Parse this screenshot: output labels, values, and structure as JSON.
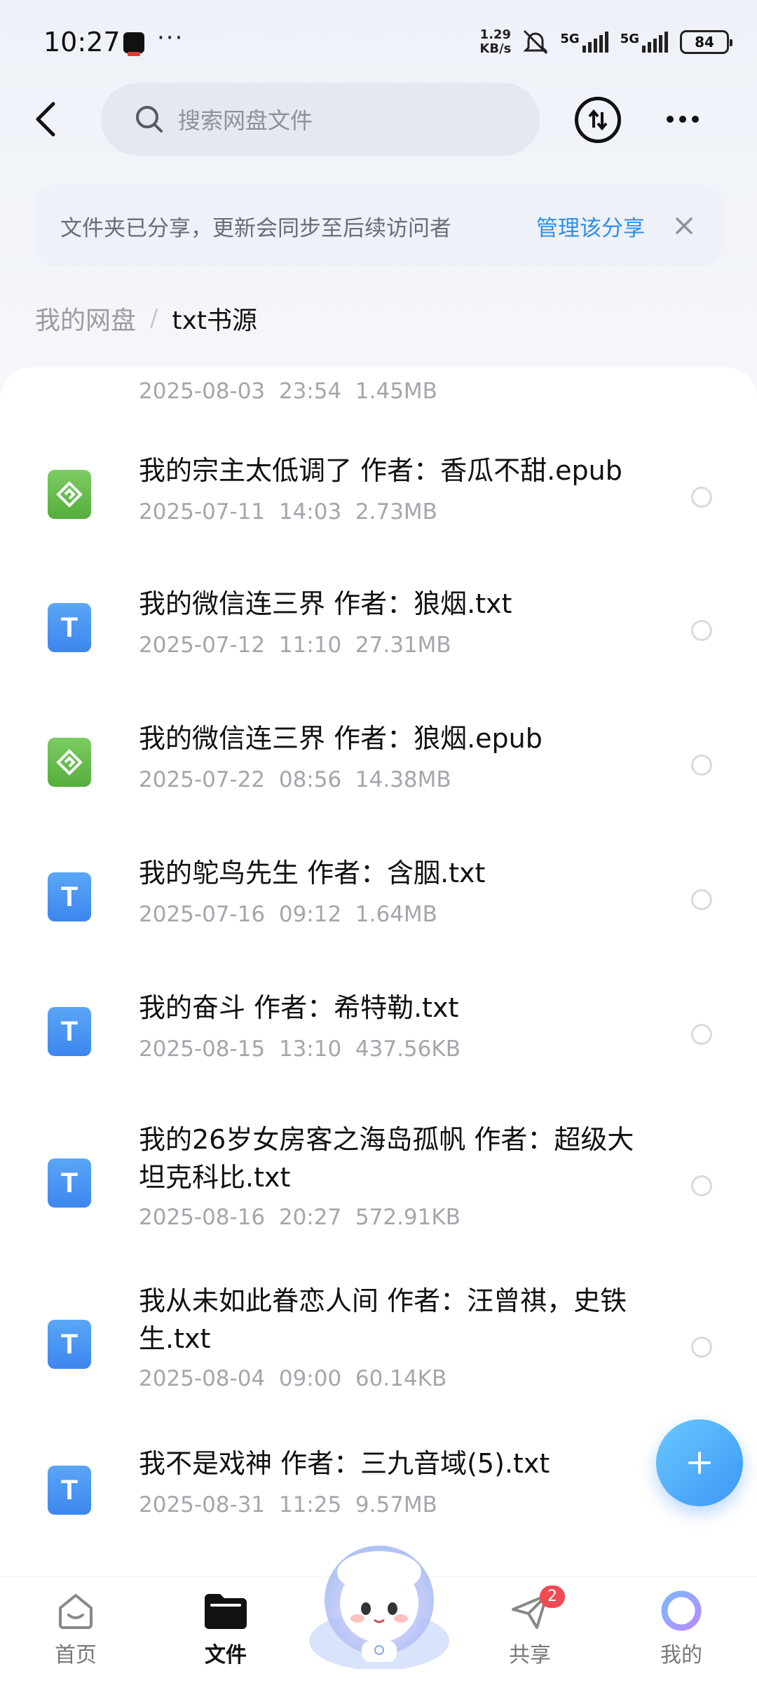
{
  "status_bar": {
    "time": "10:27",
    "more": "···",
    "net_speed_value": "1.29",
    "net_speed_unit": "KB/s",
    "signal_1": "5G",
    "signal_2": "5G",
    "battery": "84"
  },
  "header": {
    "search_placeholder": "搜索网盘文件"
  },
  "banner": {
    "text": "文件夹已分享，更新会同步至后续访问者",
    "link": "管理该分享"
  },
  "breadcrumb": {
    "root": "我的网盘",
    "separator": "/",
    "current": "txt书源"
  },
  "files": [
    {
      "name": "",
      "date": "2025-08-03",
      "time": "23:54",
      "size": "1.45MB",
      "type": "partial"
    },
    {
      "name": "我的宗主太低调了 作者：香瓜不甜.epub",
      "date": "2025-07-11",
      "time": "14:03",
      "size": "2.73MB",
      "type": "epub"
    },
    {
      "name": "我的微信连三界 作者：狼烟.txt",
      "date": "2025-07-12",
      "time": "11:10",
      "size": "27.31MB",
      "type": "txt"
    },
    {
      "name": "我的微信连三界 作者：狼烟.epub",
      "date": "2025-07-22",
      "time": "08:56",
      "size": "14.38MB",
      "type": "epub"
    },
    {
      "name": "我的鸵鸟先生 作者：含胭.txt",
      "date": "2025-07-16",
      "time": "09:12",
      "size": "1.64MB",
      "type": "txt"
    },
    {
      "name": "我的奋斗 作者：希特勒.txt",
      "date": "2025-08-15",
      "time": "13:10",
      "size": "437.56KB",
      "type": "txt"
    },
    {
      "name": "我的26岁女房客之海岛孤帆 作者：超级大坦克科比.txt",
      "date": "2025-08-16",
      "time": "20:27",
      "size": "572.91KB",
      "type": "txt"
    },
    {
      "name": "我从未如此眷恋人间 作者：汪曾祺，史铁生.txt",
      "date": "2025-08-04",
      "time": "09:00",
      "size": "60.14KB",
      "type": "txt"
    },
    {
      "name": "我不是戏神 作者：三九音域(5).txt",
      "date": "2025-08-31",
      "time": "11:25",
      "size": "9.57MB",
      "type": "txt"
    }
  ],
  "file_meta": [
    "2025-08-03  23:54  1.45MB",
    "2025-07-11  14:03  2.73MB",
    "2025-07-12  11:10  27.31MB",
    "2025-07-22  08:56  14.38MB",
    "2025-07-16  09:12  1.64MB",
    "2025-08-15  13:10  437.56KB",
    "2025-08-16  20:27  572.91KB",
    "2025-08-04  09:00  60.14KB",
    "2025-08-31  11:25  9.57MB"
  ],
  "bottom_nav": {
    "home": "首页",
    "files": "文件",
    "share": "共享",
    "share_badge": "2",
    "mine": "我的"
  },
  "colors": {
    "accent": "#2f8fe8",
    "txt_icon": "#4a94f0",
    "epub_icon": "#68bf4f",
    "badge": "#f04a52"
  }
}
